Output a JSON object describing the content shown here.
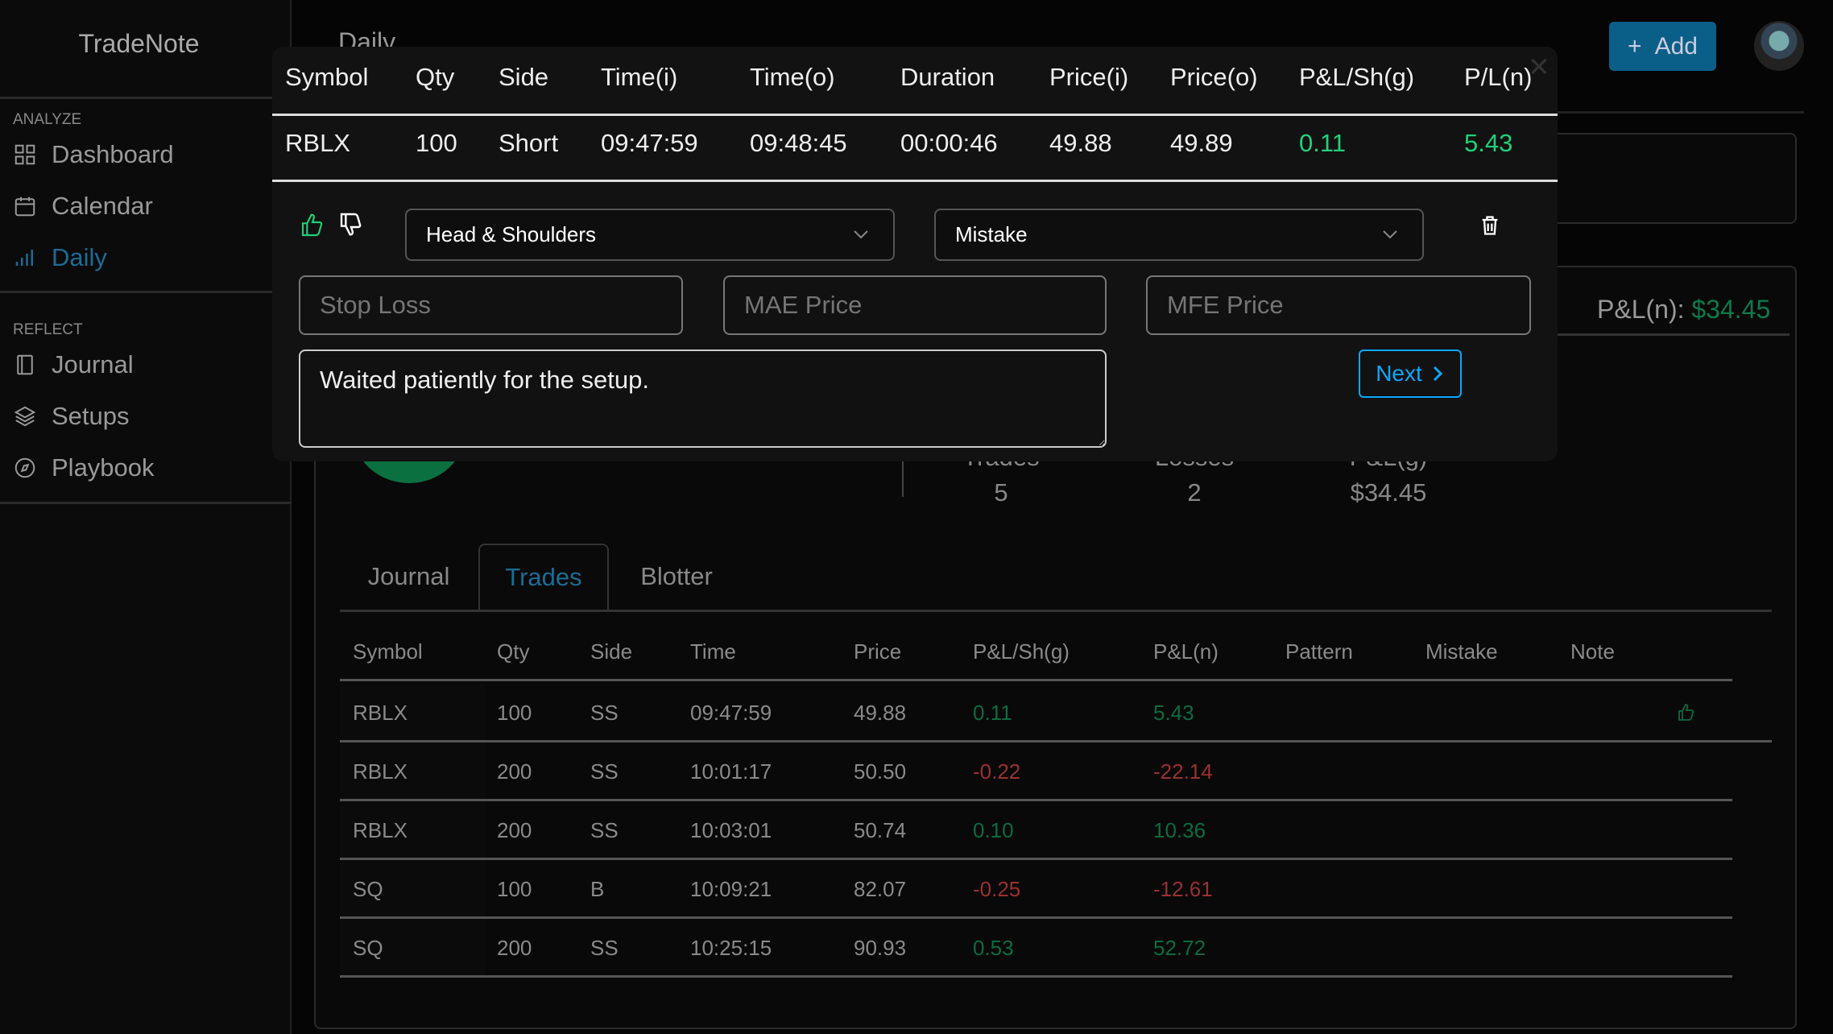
{
  "app": {
    "brand": "TradeNote"
  },
  "sidebar": {
    "sections": [
      {
        "title": "ANALYZE",
        "items": [
          {
            "label": "Dashboard",
            "icon": "grid-icon"
          },
          {
            "label": "Calendar",
            "icon": "calendar-icon"
          },
          {
            "label": "Daily",
            "icon": "bar-chart-icon",
            "active": true
          }
        ]
      },
      {
        "title": "REFLECT",
        "items": [
          {
            "label": "Journal",
            "icon": "book-icon"
          },
          {
            "label": "Setups",
            "icon": "layers-icon"
          },
          {
            "label": "Playbook",
            "icon": "compass-icon"
          }
        ]
      }
    ]
  },
  "header": {
    "title": "Daily",
    "add_label": "Add"
  },
  "summary": {
    "pnl_label": "P&L(n):",
    "pnl_value": "$34.45",
    "stats": [
      {
        "label": "Trades",
        "value": "5"
      },
      {
        "label": "Losses",
        "value": "2"
      },
      {
        "label": "P&L(g)",
        "value": "$34.45"
      }
    ]
  },
  "tabs": [
    {
      "label": "Journal"
    },
    {
      "label": "Trades",
      "active": true
    },
    {
      "label": "Blotter"
    }
  ],
  "trades": {
    "columns": [
      "Symbol",
      "Qty",
      "Side",
      "Time",
      "Price",
      "P&L/Sh(g)",
      "P&L(n)",
      "Pattern",
      "Mistake",
      "Note"
    ],
    "rows": [
      [
        "RBLX",
        "100",
        "SS",
        "09:47:59",
        "49.88",
        "0.11",
        "5.43"
      ],
      [
        "RBLX",
        "200",
        "SS",
        "10:01:17",
        "50.50",
        "-0.22",
        "-22.14"
      ],
      [
        "RBLX",
        "200",
        "SS",
        "10:03:01",
        "50.74",
        "0.10",
        "10.36"
      ],
      [
        "SQ",
        "100",
        "B",
        "10:09:21",
        "82.07",
        "-0.25",
        "-12.61"
      ],
      [
        "SQ",
        "200",
        "SS",
        "10:25:15",
        "90.93",
        "0.53",
        "52.72"
      ]
    ]
  },
  "modal": {
    "columns": [
      "Symbol",
      "Qty",
      "Side",
      "Time(i)",
      "Time(o)",
      "Duration",
      "Price(i)",
      "Price(o)",
      "P&L/Sh(g)",
      "P/L(n)"
    ],
    "row": [
      "RBLX",
      "100",
      "Short",
      "09:47:59",
      "09:48:45",
      "00:00:46",
      "49.88",
      "49.89",
      "0.11",
      "5.43"
    ],
    "pattern_select": "Head & Shoulders",
    "mistake_select": "Mistake",
    "stop_loss_placeholder": "Stop Loss",
    "mae_placeholder": "MAE Price",
    "mfe_placeholder": "MFE Price",
    "note_value": "Waited patiently for the setup.",
    "next_label": "Next"
  },
  "colors": {
    "accent": "#0a5f88",
    "positive": "#0b6b40",
    "negative": "#9a3030",
    "modal_positive": "#1fd17a",
    "next": "#0aa8ff"
  }
}
